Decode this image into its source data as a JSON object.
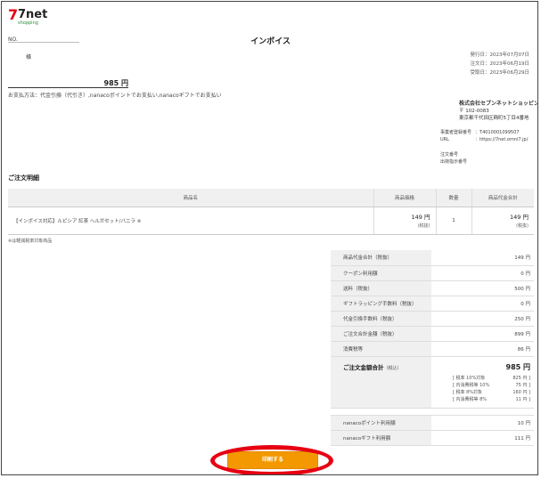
{
  "header": {
    "logo_brand": "7net",
    "logo_sub": "shopping",
    "no_label": "NO.",
    "title": "インボイス"
  },
  "dates": {
    "issued": "発行日：2023年07月07日",
    "ordered": "注文日：2023年06月19日",
    "delivered": "受取日：2023年06月29日"
  },
  "customer": {
    "honorific": "様",
    "total": "985 円",
    "payment_method": "お支払方法：代金引換（代引き）,nanacoポイントでお支払い,nanacoギフトでお支払い"
  },
  "company": {
    "name": "株式会社セブンネットショッピング",
    "postal": "〒 102-0083",
    "address": "東京都千代田区麹町5丁目4番地",
    "reg_label": "事業者登録番号",
    "reg_value": "：T4010001099507",
    "url_label": "URL",
    "url_value": "：https://7net.omni7.jp/",
    "order_no_label": "注文番号",
    "shipment_no_label": "出荷指示番号"
  },
  "items_section": {
    "title": "ご注文明細",
    "headers": [
      "商品名",
      "商品価格",
      "数量",
      "商品代金合計"
    ],
    "rows": [
      {
        "name": "【インボイス対応】ルピシア 紅茶 ヘルガセット/バニラ ※",
        "price": "149 円",
        "price_note": "(税抜)",
        "qty": "1",
        "subtotal": "149 円",
        "subtotal_note": "(税抜)"
      }
    ],
    "tax_note": "※は軽減税率対象商品"
  },
  "summary": {
    "rows": [
      {
        "label": "商品代金合計（税抜）",
        "value": "149 円"
      },
      {
        "label": "クーポン利用額",
        "value": "0 円"
      },
      {
        "label": "送料（税抜）",
        "value": "500 円"
      },
      {
        "label": "ギフトラッピング手数料（税抜）",
        "value": "0 円"
      },
      {
        "label": "代金引換手数料（税抜）",
        "value": "250 円"
      },
      {
        "label": "ご注文合計金額（税抜）",
        "value": "899 円"
      },
      {
        "label": "消費税等",
        "value": "86 円"
      }
    ],
    "grand_label": "ご注文金額合計",
    "grand_label_note": "（税込）",
    "grand_value": "985 円",
    "breakdown": [
      {
        "label": "[ 税率 10%対象",
        "value": "825 円 ]"
      },
      {
        "label": "[ 内消費税等 10%",
        "value": "75 円 ]"
      },
      {
        "label": "[ 税率 8%対象",
        "value": "160 円 ]"
      },
      {
        "label": "[ 内消費税等 8%",
        "value": "11 円 ]"
      }
    ],
    "nanaco_rows": [
      {
        "label": "nanacoポイント利用額",
        "value": "10 円"
      },
      {
        "label": "nanacoギフト利用額",
        "value": "111 円"
      }
    ]
  },
  "print_button": "印刷する",
  "colors": {
    "accent": "#f39800",
    "highlight": "#e60012"
  }
}
